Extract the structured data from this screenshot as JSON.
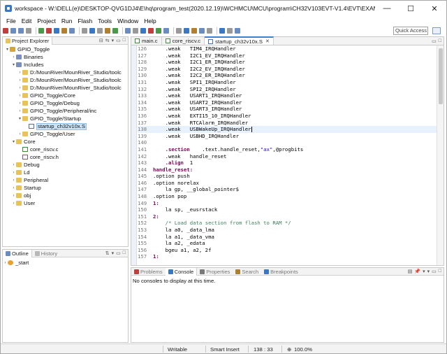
{
  "window": {
    "title": "workspace - W:\\DELL(e)\\DESKTOP-QVG1DJ4\\E\\hq\\program_test(2020.12.19)\\WCHMCU\\MCU\\program\\CH32V103EVT-V1.4\\EVT\\EXAM\\SRC\\Startu...",
    "minimize": "—",
    "maximize": "☐",
    "close": "✕"
  },
  "menu": [
    "File",
    "Edit",
    "Project",
    "Run",
    "Flash",
    "Tools",
    "Window",
    "Help"
  ],
  "toolbar": {
    "quick_access": "Quick Access",
    "icon_colors": [
      "#c04040",
      "#6a8cc0",
      "#6a8cc0",
      "#999999",
      "#4a9a4a",
      "#c04040",
      "#3a78c5",
      "#b08030",
      "#6a8cc0",
      "#999999",
      "#3a78c5",
      "#999999",
      "#b08030",
      "#4a9a4a",
      "#6a8cc0",
      "#999999",
      "#3a78c5",
      "#c04040",
      "#4a9a4a",
      "#6a8cc0",
      "#999999",
      "#3a78c5",
      "#b08030",
      "#6a8cc0",
      "#999999",
      "#3a78c5",
      "#999999",
      "#6a8cc0"
    ]
  },
  "project_explorer": {
    "tab": "Project Explorer",
    "tree": [
      {
        "label": "GPIO_Toggle",
        "indent": 0,
        "arrow": "▾",
        "icon": "proj"
      },
      {
        "label": "Binaries",
        "indent": 1,
        "arrow": "›",
        "icon": "lib"
      },
      {
        "label": "Includes",
        "indent": 1,
        "arrow": "▾",
        "icon": "lib"
      },
      {
        "label": "D:/MounRiver/MounRiver_Studio/toolc",
        "indent": 2,
        "arrow": "›",
        "icon": "folder"
      },
      {
        "label": "D:/MounRiver/MounRiver_Studio/toolc",
        "indent": 2,
        "arrow": "›",
        "icon": "folder"
      },
      {
        "label": "D:/MounRiver/MounRiver_Studio/toolc",
        "indent": 2,
        "arrow": "›",
        "icon": "folder"
      },
      {
        "label": "GPIO_Toggle/Core",
        "indent": 2,
        "arrow": "›",
        "icon": "folder"
      },
      {
        "label": "GPIO_Toggle/Debug",
        "indent": 2,
        "arrow": "›",
        "icon": "folder"
      },
      {
        "label": "GPIO_Toggle/Peripheral/inc",
        "indent": 2,
        "arrow": "›",
        "icon": "folder"
      },
      {
        "label": "GPIO_Toggle/Startup",
        "indent": 2,
        "arrow": "▾",
        "icon": "folder"
      },
      {
        "label": "startup_ch32v10x.S",
        "indent": 3,
        "arrow": "",
        "icon": "file-s",
        "selected": true
      },
      {
        "label": "GPIO_Toggle/User",
        "indent": 2,
        "arrow": "›",
        "icon": "folder"
      },
      {
        "label": "Core",
        "indent": 1,
        "arrow": "▾",
        "icon": "folder"
      },
      {
        "label": "core_riscv.c",
        "indent": 2,
        "arrow": "",
        "icon": "file-c"
      },
      {
        "label": "core_riscv.h",
        "indent": 2,
        "arrow": "",
        "icon": "file-h"
      },
      {
        "label": "Debug",
        "indent": 1,
        "arrow": "›",
        "icon": "folder"
      },
      {
        "label": "Ld",
        "indent": 1,
        "arrow": "›",
        "icon": "folder"
      },
      {
        "label": "Peripheral",
        "indent": 1,
        "arrow": "›",
        "icon": "folder"
      },
      {
        "label": "Startup",
        "indent": 1,
        "arrow": "›",
        "icon": "folder"
      },
      {
        "label": "obj",
        "indent": 1,
        "arrow": "›",
        "icon": "folder"
      },
      {
        "label": "User",
        "indent": 1,
        "arrow": "›",
        "icon": "folder"
      }
    ]
  },
  "outline": {
    "tab_outline": "Outline",
    "tab_history": "History",
    "items": [
      {
        "label": "_start",
        "arrow": "›"
      }
    ]
  },
  "editor": {
    "tabs": [
      {
        "label": "main.c",
        "active": false,
        "icon": "file-c"
      },
      {
        "label": "core_riscv.c",
        "active": false,
        "icon": "file-c"
      },
      {
        "label": "startup_ch32v10x.S",
        "active": true,
        "icon": "file-s"
      }
    ],
    "lines": [
      {
        "n": "126",
        "parts": [
          [
            "",
            "    .weak   TIM4_IRQHandler"
          ]
        ]
      },
      {
        "n": "127",
        "parts": [
          [
            "",
            "    .weak   I2C1_EV_IRQHandler"
          ]
        ]
      },
      {
        "n": "128",
        "parts": [
          [
            "",
            "    .weak   I2C1_ER_IRQHandler"
          ]
        ]
      },
      {
        "n": "129",
        "parts": [
          [
            "",
            "    .weak   I2C2_EV_IRQHandler"
          ]
        ]
      },
      {
        "n": "130",
        "parts": [
          [
            "",
            "    .weak   I2C2_ER_IRQHandler"
          ]
        ]
      },
      {
        "n": "131",
        "parts": [
          [
            "",
            "    .weak   SPI1_IRQHandler"
          ]
        ]
      },
      {
        "n": "132",
        "parts": [
          [
            "",
            "    .weak   SPI2_IRQHandler"
          ]
        ]
      },
      {
        "n": "133",
        "parts": [
          [
            "",
            "    .weak   USART1_IRQHandler"
          ]
        ]
      },
      {
        "n": "134",
        "parts": [
          [
            "",
            "    .weak   USART2_IRQHandler"
          ]
        ]
      },
      {
        "n": "135",
        "parts": [
          [
            "",
            "    .weak   USART3_IRQHandler"
          ]
        ]
      },
      {
        "n": "136",
        "parts": [
          [
            "",
            "    .weak   EXTI15_10_IRQHandler"
          ]
        ]
      },
      {
        "n": "137",
        "parts": [
          [
            "",
            "    .weak   RTCAlarm_IRQHandler"
          ]
        ]
      },
      {
        "n": "138",
        "parts": [
          [
            "",
            "    .weak   USBWakeUp_IRQHandler"
          ]
        ],
        "highlight": true,
        "cursor": true
      },
      {
        "n": "139",
        "parts": [
          [
            "",
            "    .weak   USBHD_IRQHandler"
          ]
        ]
      },
      {
        "n": "140",
        "parts": []
      },
      {
        "n": "141",
        "parts": [
          [
            "",
            "    "
          ],
          [
            "dr",
            ".section"
          ],
          [
            "",
            "    .text.handle_reset,"
          ],
          [
            "st",
            "\"ax\""
          ],
          [
            "",
            ",@progbits"
          ]
        ]
      },
      {
        "n": "142",
        "parts": [
          [
            "",
            "    .weak   handle_reset"
          ]
        ]
      },
      {
        "n": "143",
        "parts": [
          [
            "",
            "    "
          ],
          [
            "dr",
            ".align"
          ],
          [
            "",
            "  1"
          ]
        ]
      },
      {
        "n": "144",
        "parts": [
          [
            "lbl",
            "handle_reset:"
          ]
        ]
      },
      {
        "n": "145",
        "parts": [
          [
            "",
            ".option push"
          ]
        ]
      },
      {
        "n": "146",
        "parts": [
          [
            "",
            ".option norelax"
          ]
        ]
      },
      {
        "n": "147",
        "parts": [
          [
            "",
            "    la gp, __global_pointer$"
          ]
        ]
      },
      {
        "n": "148",
        "parts": [
          [
            "",
            ".option pop"
          ]
        ]
      },
      {
        "n": "149",
        "parts": [
          [
            "lbl",
            "1:"
          ]
        ]
      },
      {
        "n": "150",
        "parts": [
          [
            "",
            "    la sp, _eusrstack"
          ]
        ]
      },
      {
        "n": "151",
        "parts": [
          [
            "lbl",
            "2:"
          ]
        ]
      },
      {
        "n": "152",
        "parts": [
          [
            "",
            "    "
          ],
          [
            "cm",
            "/* Load data section from flash to RAM */"
          ]
        ]
      },
      {
        "n": "153",
        "parts": [
          [
            "",
            "    la a0, _data_lma"
          ]
        ]
      },
      {
        "n": "154",
        "parts": [
          [
            "",
            "    la a1, _data_vma"
          ]
        ]
      },
      {
        "n": "155",
        "parts": [
          [
            "",
            "    la a2, _edata"
          ]
        ]
      },
      {
        "n": "156",
        "parts": [
          [
            "",
            "    bgeu a1, a2, 2f"
          ]
        ]
      },
      {
        "n": "157",
        "parts": [
          [
            "lbl",
            "1:"
          ]
        ]
      }
    ]
  },
  "console": {
    "tabs": [
      {
        "label": "Problems",
        "active": false
      },
      {
        "label": "Console",
        "active": true
      },
      {
        "label": "Properties",
        "active": false
      },
      {
        "label": "Search",
        "active": false
      },
      {
        "label": "Breakpoints",
        "active": false
      }
    ],
    "message": "No consoles to display at this time."
  },
  "status": {
    "mode": "Writable",
    "insert": "Smart Insert",
    "position": "138 : 33",
    "zoom": "100.0%"
  }
}
